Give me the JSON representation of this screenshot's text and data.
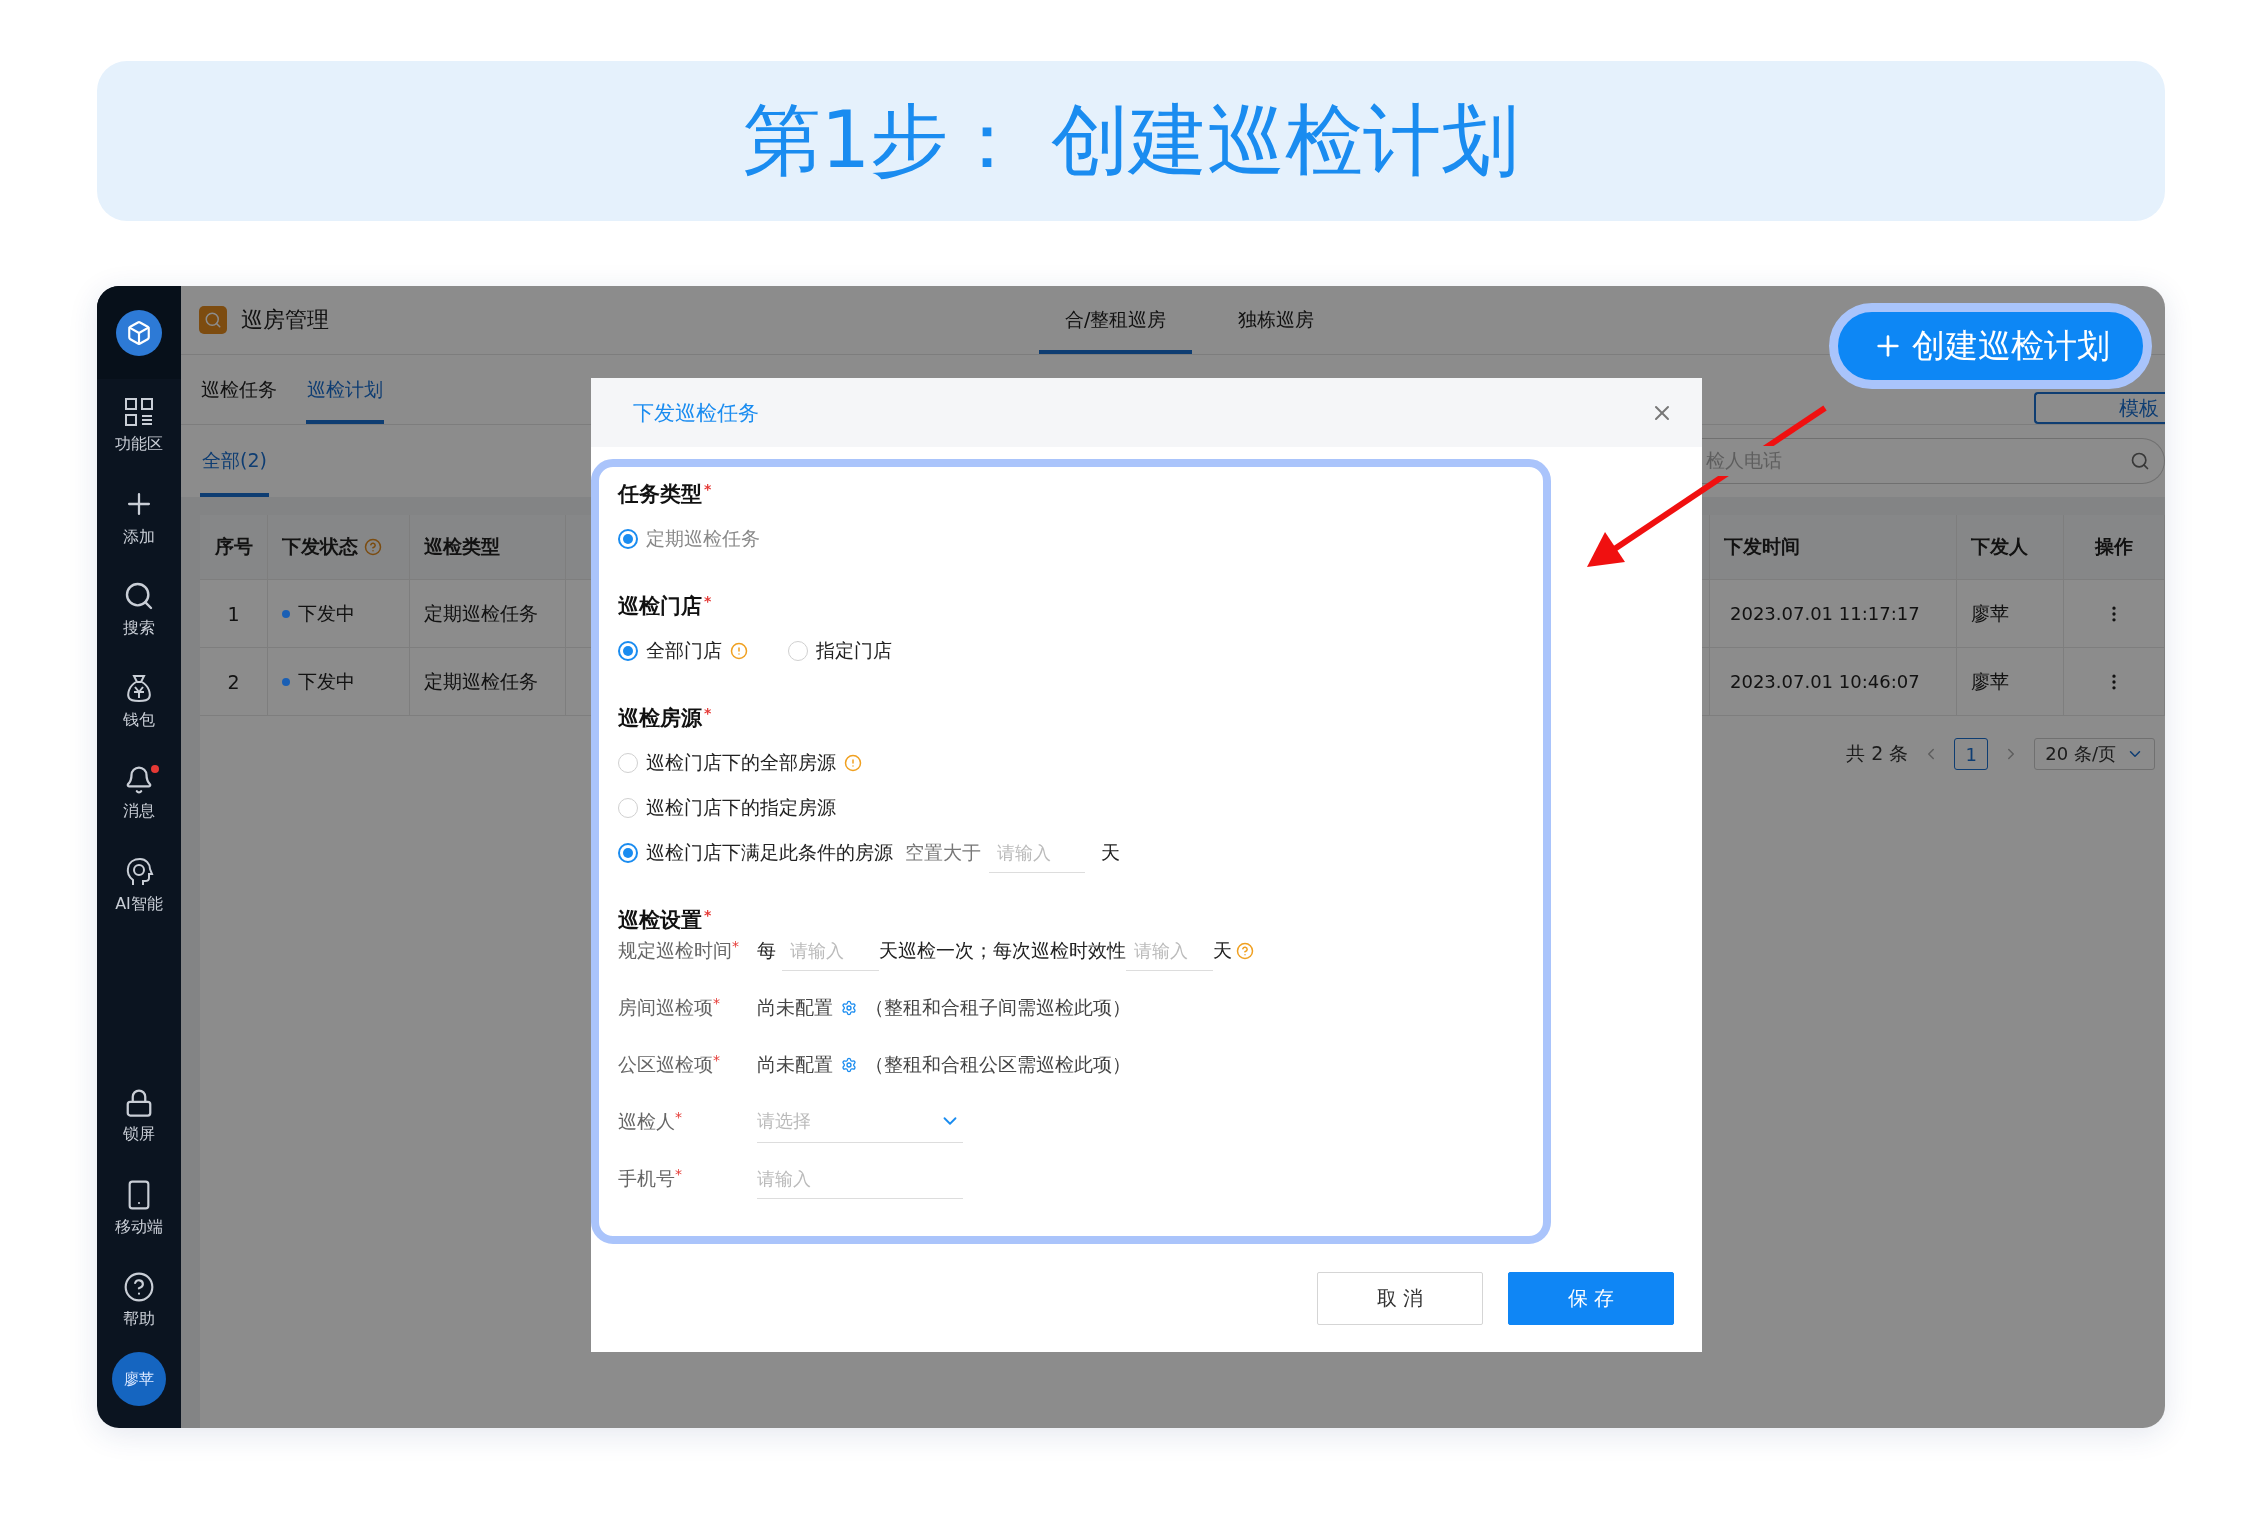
{
  "banner": {
    "title": "第1步： 创建巡检计划"
  },
  "sidebar": {
    "items": [
      {
        "label": "功能区",
        "kind": "grid",
        "badge": false
      },
      {
        "label": "添加",
        "kind": "plus",
        "badge": false
      },
      {
        "label": "搜索",
        "kind": "search",
        "badge": false
      },
      {
        "label": "钱包",
        "kind": "wallet",
        "badge": false
      },
      {
        "label": "消息",
        "kind": "bell",
        "badge": true
      },
      {
        "label": "AI智能",
        "kind": "ai",
        "badge": false
      }
    ],
    "bottom_items": [
      {
        "label": "锁屏",
        "kind": "lock"
      },
      {
        "label": "移动端",
        "kind": "phone"
      },
      {
        "label": "帮助",
        "kind": "help"
      }
    ],
    "avatar": "廖苹"
  },
  "header": {
    "title": "巡房管理",
    "tabs": [
      {
        "label": "合/整租巡房",
        "selected": true
      },
      {
        "label": "独栋巡房",
        "selected": false
      }
    ]
  },
  "sub_tabs": [
    {
      "label": "巡检任务",
      "selected": false
    },
    {
      "label": "巡检计划",
      "selected": true
    }
  ],
  "template_button": "模板",
  "filter_tabs": [
    {
      "label": "全部(2)",
      "selected": true
    }
  ],
  "search": {
    "placeholder": "检人电话"
  },
  "table": {
    "columns": [
      {
        "label": "序号",
        "help": false
      },
      {
        "label": "下发状态",
        "help": true
      },
      {
        "label": "巡检类型",
        "help": false
      },
      {
        "label": "下发时间",
        "help": false
      },
      {
        "label": "下发人",
        "help": false
      },
      {
        "label": "操作",
        "help": false
      }
    ],
    "rows": [
      {
        "index": "1",
        "status": "下发中",
        "color": "#1a5fb4",
        "type": "定期巡检任务",
        "time": "2023.07.01 11:17:17",
        "issuer": "廖苹"
      },
      {
        "index": "2",
        "status": "下发中",
        "color": "#1a5fb4",
        "type": "定期巡检任务",
        "time": "2023.07.01 10:46:07",
        "issuer": "廖苹"
      }
    ]
  },
  "pagination": {
    "total": "共 2 条",
    "pages": [
      {
        "label": "1",
        "selected": true
      }
    ],
    "page_size": "20 条/页"
  },
  "dialog": {
    "title": "下发巡检任务",
    "sections": [
      {
        "title": "任务类型",
        "required": "*",
        "options": [
          {
            "label": "定期巡检任务",
            "selected": true,
            "disabled": true
          }
        ]
      },
      {
        "title": "巡检门店",
        "required": "*",
        "inline": true,
        "options": [
          {
            "label": "全部门店",
            "selected": true,
            "disabled": false,
            "info": true
          },
          {
            "label": "指定门店",
            "selected": false,
            "disabled": false
          }
        ]
      },
      {
        "title": "巡检房源",
        "required": "*",
        "inline": false,
        "options": [
          {
            "label": "巡检门店下的全部房源",
            "selected": false,
            "disabled": false,
            "info": true
          },
          {
            "label": "巡检门店下的指定房源",
            "selected": false,
            "disabled": false
          },
          {
            "label": "巡检门店下满足此条件的房源",
            "selected": true,
            "disabled": false,
            "condition": {
              "label": "空置大于",
              "placeholder": "请输入",
              "unit": "天"
            }
          }
        ]
      }
    ],
    "settings": {
      "title": "巡检设置",
      "required": "*",
      "rows": [
        {
          "kind": "period",
          "label": "规定巡检时间",
          "required": "*",
          "prefix": "每",
          "placeholder": "请输入",
          "middle": "天巡检一次；每次巡检时效性",
          "placeholder2": "请输入",
          "unit": "天"
        },
        {
          "kind": "config",
          "label": "房间巡检项",
          "required": "*",
          "value": "尚未配置",
          "note": "（整租和合租子间需巡检此项）"
        },
        {
          "kind": "config",
          "label": "公区巡检项",
          "required": "*",
          "value": "尚未配置",
          "note": "（整租和合租公区需巡检此项）"
        },
        {
          "kind": "select",
          "label": "巡检人",
          "required": "*",
          "placeholder": "请选择"
        },
        {
          "kind": "input",
          "label": "手机号",
          "required": "*",
          "placeholder": "请输入"
        }
      ]
    },
    "buttons": [
      {
        "label": "取 消",
        "kind": "default"
      },
      {
        "label": "保 存",
        "kind": "primary"
      }
    ]
  },
  "callout": {
    "label": "创建巡检计划"
  }
}
